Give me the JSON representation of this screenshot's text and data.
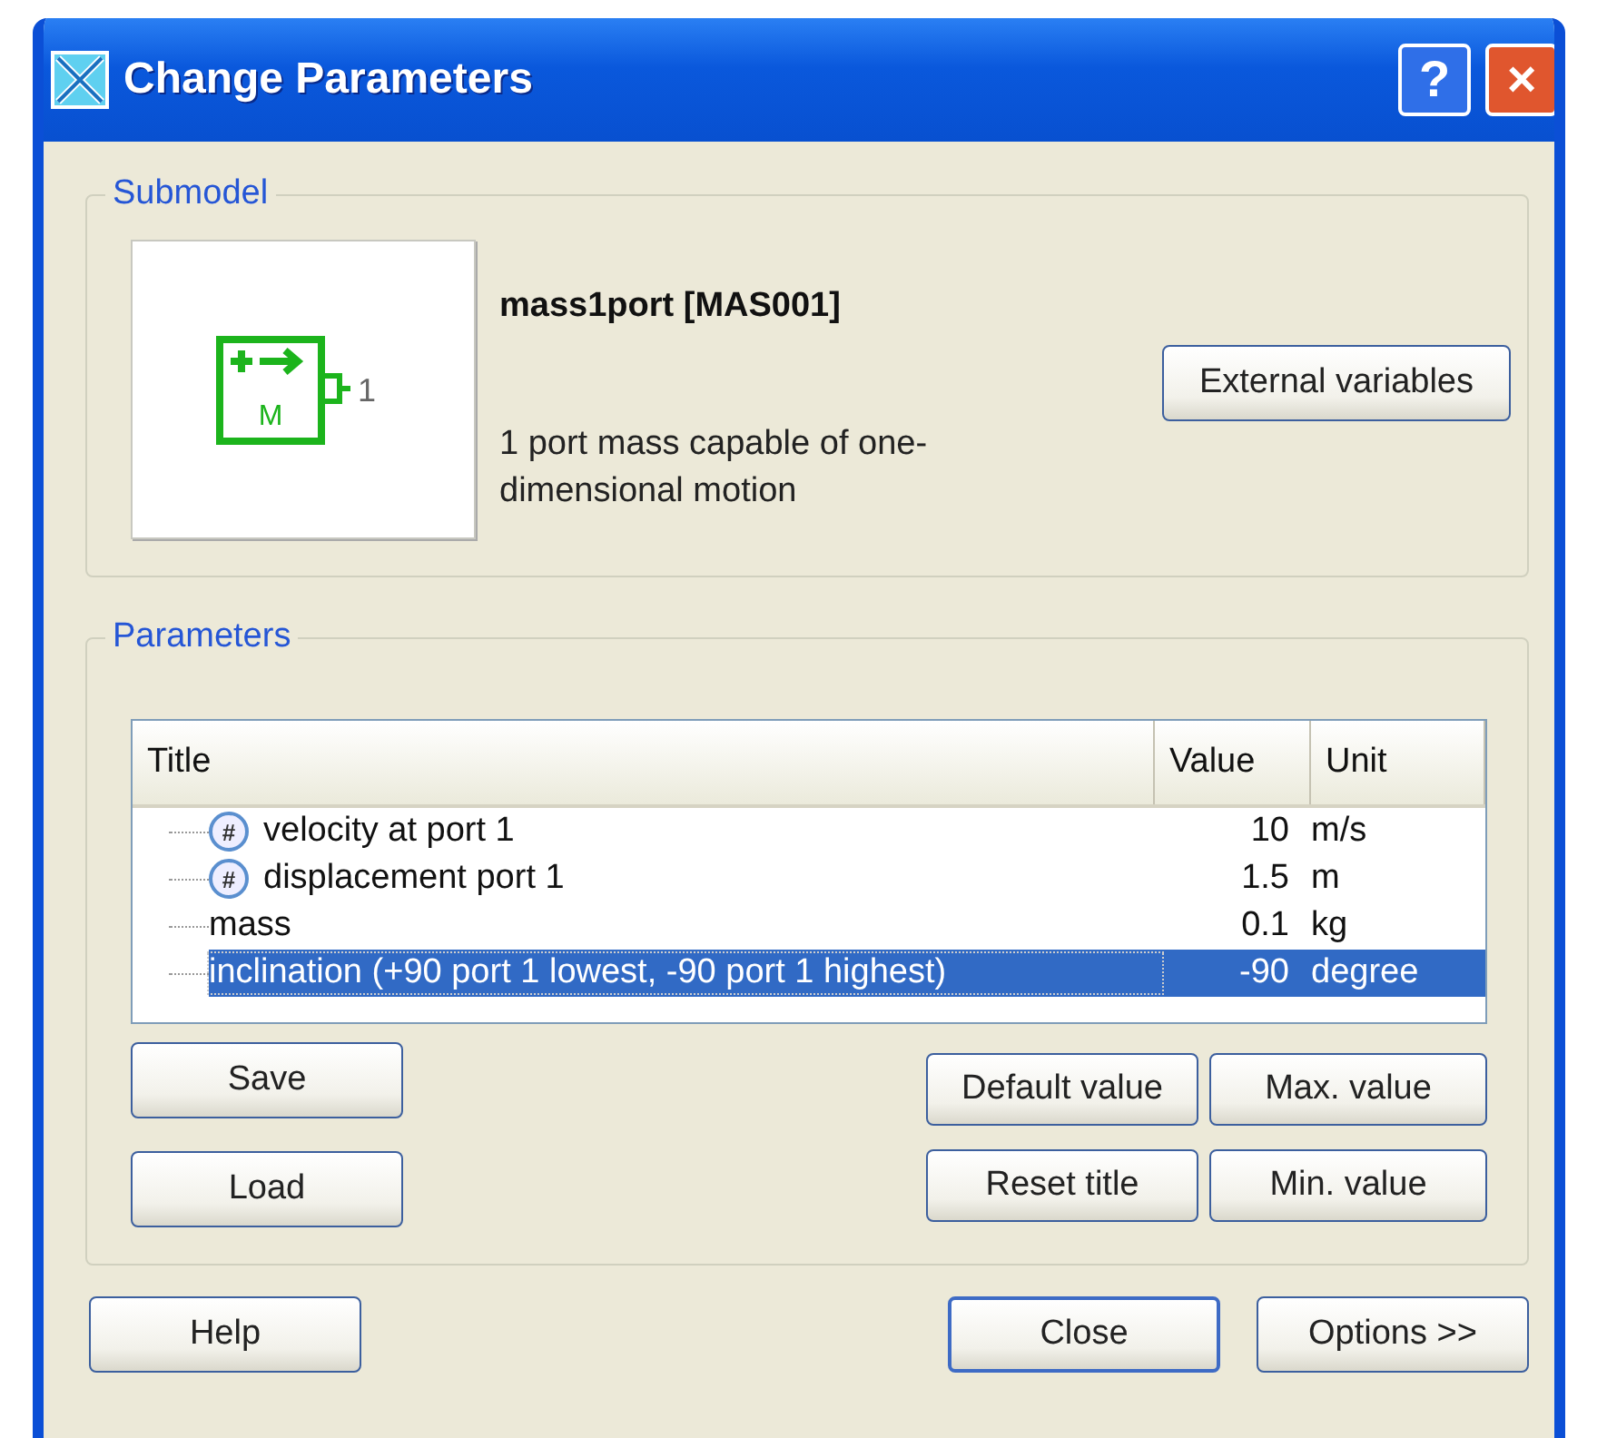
{
  "window": {
    "title": "Change Parameters",
    "title_buttons": [
      "?",
      "×"
    ]
  },
  "submodel": {
    "legend": "Submodel",
    "icon_port_label": "1",
    "icon_letter": "M",
    "name": "mass1port [MAS001]",
    "description": "1 port mass capable of one-dimensional motion",
    "button": "External variables"
  },
  "parameters": {
    "legend": "Parameters",
    "columns": [
      "Title",
      "Value",
      "Unit"
    ],
    "rows": [
      {
        "kind": "state",
        "badge": "#",
        "title": "velocity at port 1",
        "value": "10",
        "unit": "m/s",
        "selected": false
      },
      {
        "kind": "state",
        "badge": "#",
        "title": "displacement port 1",
        "value": "1.5",
        "unit": "m",
        "selected": false
      },
      {
        "kind": "plain",
        "title": "mass",
        "value": "0.1",
        "unit": "kg",
        "selected": false
      },
      {
        "kind": "plain",
        "title": "inclination (+90 port 1 lowest, -90 port 1 highest)",
        "value": "-90",
        "unit": "degree",
        "selected": true
      }
    ],
    "left_buttons": [
      "Save",
      "Load"
    ],
    "right_buttons": [
      [
        "Default value",
        "Max. value"
      ],
      [
        "Reset title",
        "Min. value"
      ]
    ]
  },
  "footer": {
    "left_button": "Help",
    "right_buttons": [
      {
        "label": "Close",
        "default": true
      },
      {
        "label": "Options >>",
        "default": false
      }
    ]
  }
}
